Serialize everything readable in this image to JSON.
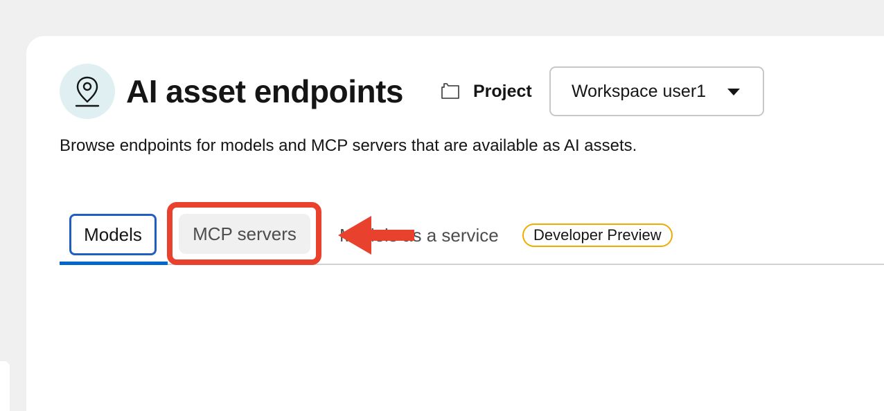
{
  "header": {
    "title": "AI asset endpoints",
    "icon": "location-pin-icon",
    "icon_bg_color": "#e0f0f2"
  },
  "project": {
    "label": "Project",
    "icon": "folder-icon",
    "selected": "Workspace user1"
  },
  "description": "Browse endpoints for models and MCP servers that are available as AI assets.",
  "tabs": [
    {
      "label": "Models",
      "active": true
    },
    {
      "label": "MCP servers",
      "active": false,
      "highlighted": true
    },
    {
      "label": "Models as a service",
      "active": false,
      "badge": "Developer Preview"
    }
  ],
  "colors": {
    "accent": "#0066cc",
    "annotation": "#e8412d",
    "badge_border": "#f0ab00"
  }
}
